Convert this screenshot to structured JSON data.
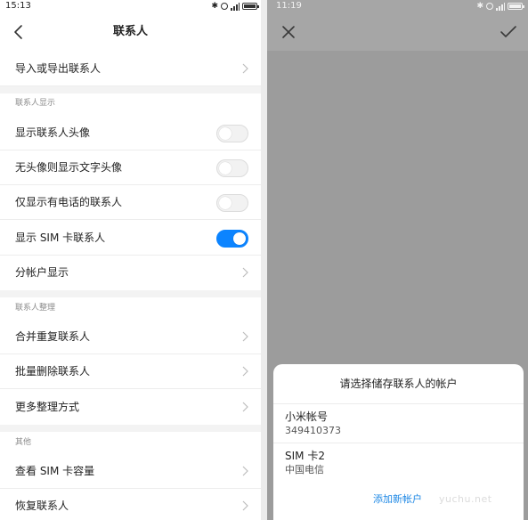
{
  "left": {
    "status": {
      "time": "15:13"
    },
    "header": {
      "title": "联系人"
    },
    "rows": {
      "import_export": "导入或导出联系人",
      "show_avatar": "显示联系人头像",
      "text_avatar": "无头像则显示文字头像",
      "phone_only": "仅显示有电话的联系人",
      "show_sim": "显示 SIM 卡联系人",
      "by_account": "分帐户显示",
      "merge_dup": "合并重复联系人",
      "batch_delete": "批量删除联系人",
      "more_org": "更多整理方式",
      "sim_capacity": "查看 SIM 卡容量",
      "restore": "恢复联系人"
    },
    "sections": {
      "display": "联系人显示",
      "organize": "联系人整理",
      "other": "其他"
    },
    "toggles": {
      "show_avatar": false,
      "text_avatar": false,
      "phone_only": false,
      "show_sim": true
    },
    "accent": "#0c84ff"
  },
  "right": {
    "status": {
      "time": "11:19"
    },
    "dialog": {
      "title": "请选择储存联系人的帐户",
      "accounts": [
        {
          "name": "小米帐号",
          "detail": "349410373"
        },
        {
          "name": "SIM 卡2",
          "detail": "中国电信"
        }
      ],
      "add_account": "添加新帐户",
      "watermark": "yuchu.net"
    }
  }
}
